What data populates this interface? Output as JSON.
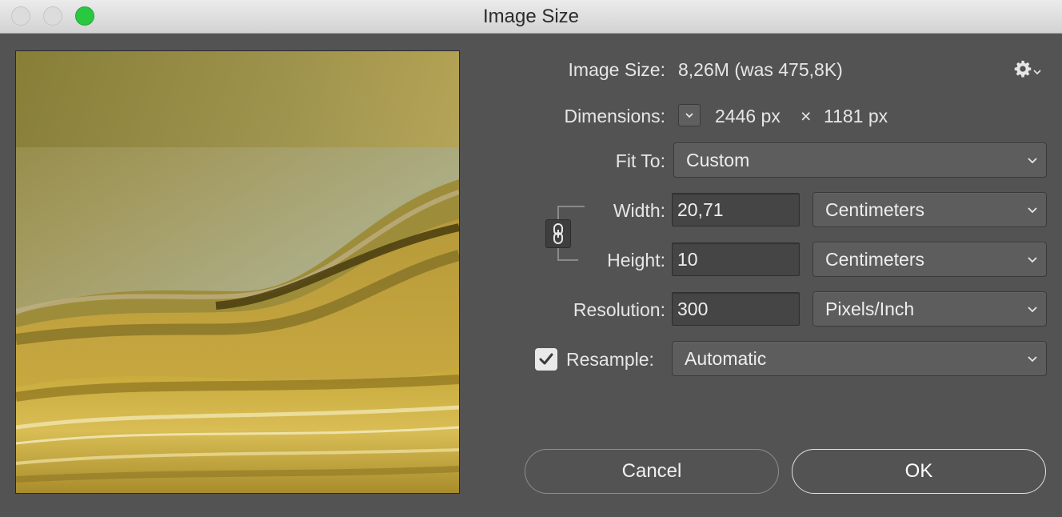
{
  "window": {
    "title": "Image Size"
  },
  "image_size": {
    "label": "Image Size:",
    "value": "8,26M (was 475,8K)"
  },
  "dimensions": {
    "label": "Dimensions:",
    "width": "2446 px",
    "times": "×",
    "height": "1181 px"
  },
  "fit_to": {
    "label": "Fit To:",
    "selected": "Custom"
  },
  "width": {
    "label": "Width:",
    "value": "20,71",
    "unit": "Centimeters"
  },
  "height": {
    "label": "Height:",
    "value": "10",
    "unit": "Centimeters"
  },
  "resolution": {
    "label": "Resolution:",
    "value": "300",
    "unit": "Pixels/Inch"
  },
  "resample": {
    "label": "Resample:",
    "checked": true,
    "selected": "Automatic"
  },
  "buttons": {
    "cancel": "Cancel",
    "ok": "OK"
  },
  "icons": {
    "settings": "gear-icon",
    "link": "chain-link-icon",
    "dimensions_menu": "chevron-down-icon"
  },
  "colors": {
    "dialog_bg": "#535353",
    "zoom_button": "#2ac840",
    "field_bg": "#454545"
  }
}
